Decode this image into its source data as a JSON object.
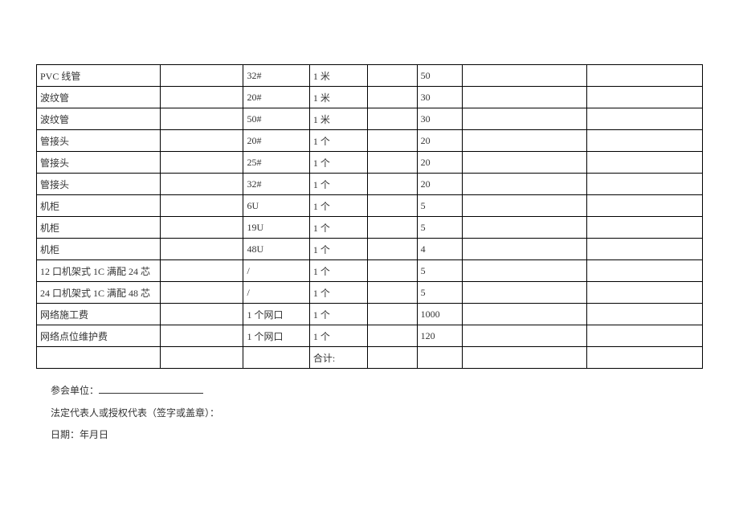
{
  "rows": [
    {
      "c0": "PVC 线管",
      "c1": "",
      "c2": "32#",
      "c3": "1 米",
      "c4": "",
      "c5": "50",
      "c6": "",
      "c7": ""
    },
    {
      "c0": "波纹管",
      "c1": "",
      "c2": "20#",
      "c3": "1 米",
      "c4": "",
      "c5": "30",
      "c6": "",
      "c7": ""
    },
    {
      "c0": "波纹管",
      "c1": "",
      "c2": "50#",
      "c3": "1 米",
      "c4": "",
      "c5": "30",
      "c6": "",
      "c7": ""
    },
    {
      "c0": "管接头",
      "c1": "",
      "c2": "20#",
      "c3": "1 个",
      "c4": "",
      "c5": "20",
      "c6": "",
      "c7": ""
    },
    {
      "c0": "管接头",
      "c1": "",
      "c2": "25#",
      "c3": "1 个",
      "c4": "",
      "c5": "20",
      "c6": "",
      "c7": ""
    },
    {
      "c0": "管接头",
      "c1": "",
      "c2": "32#",
      "c3": "1 个",
      "c4": "",
      "c5": "20",
      "c6": "",
      "c7": ""
    },
    {
      "c0": "机柜",
      "c1": "",
      "c2": "6U",
      "c3": "1 个",
      "c4": "",
      "c5": "5",
      "c6": "",
      "c7": ""
    },
    {
      "c0": "机柜",
      "c1": "",
      "c2": "19U",
      "c3": "1 个",
      "c4": "",
      "c5": "5",
      "c6": "",
      "c7": ""
    },
    {
      "c0": "机柜",
      "c1": "",
      "c2": "48U",
      "c3": "1 个",
      "c4": "",
      "c5": "4",
      "c6": "",
      "c7": ""
    },
    {
      "c0": "12 口机架式 1C 满配 24 芯",
      "c1": "",
      "c2": "/",
      "c3": "1 个",
      "c4": "",
      "c5": "5",
      "c6": "",
      "c7": ""
    },
    {
      "c0": "24 口机架式 1C 满配 48 芯",
      "c1": "",
      "c2": "/",
      "c3": "1 个",
      "c4": "",
      "c5": "5",
      "c6": "",
      "c7": ""
    },
    {
      "c0": "网络施工费",
      "c1": "",
      "c2": "1 个网口",
      "c3": "1 个",
      "c4": "",
      "c5": "1000",
      "c6": "",
      "c7": ""
    },
    {
      "c0": "网络点位维护费",
      "c1": "",
      "c2": "1 个网口",
      "c3": "1 个",
      "c4": "",
      "c5": "120",
      "c6": "",
      "c7": ""
    },
    {
      "c0": "",
      "c1": "",
      "c2": "",
      "c3": "合计:",
      "c4": "",
      "c5": "",
      "c6": "",
      "c7": ""
    }
  ],
  "footer": {
    "line1_label": "参会单位：",
    "line2": "法定代表人或授权代表（签字或盖章）：",
    "line3": "日期：年月日"
  }
}
